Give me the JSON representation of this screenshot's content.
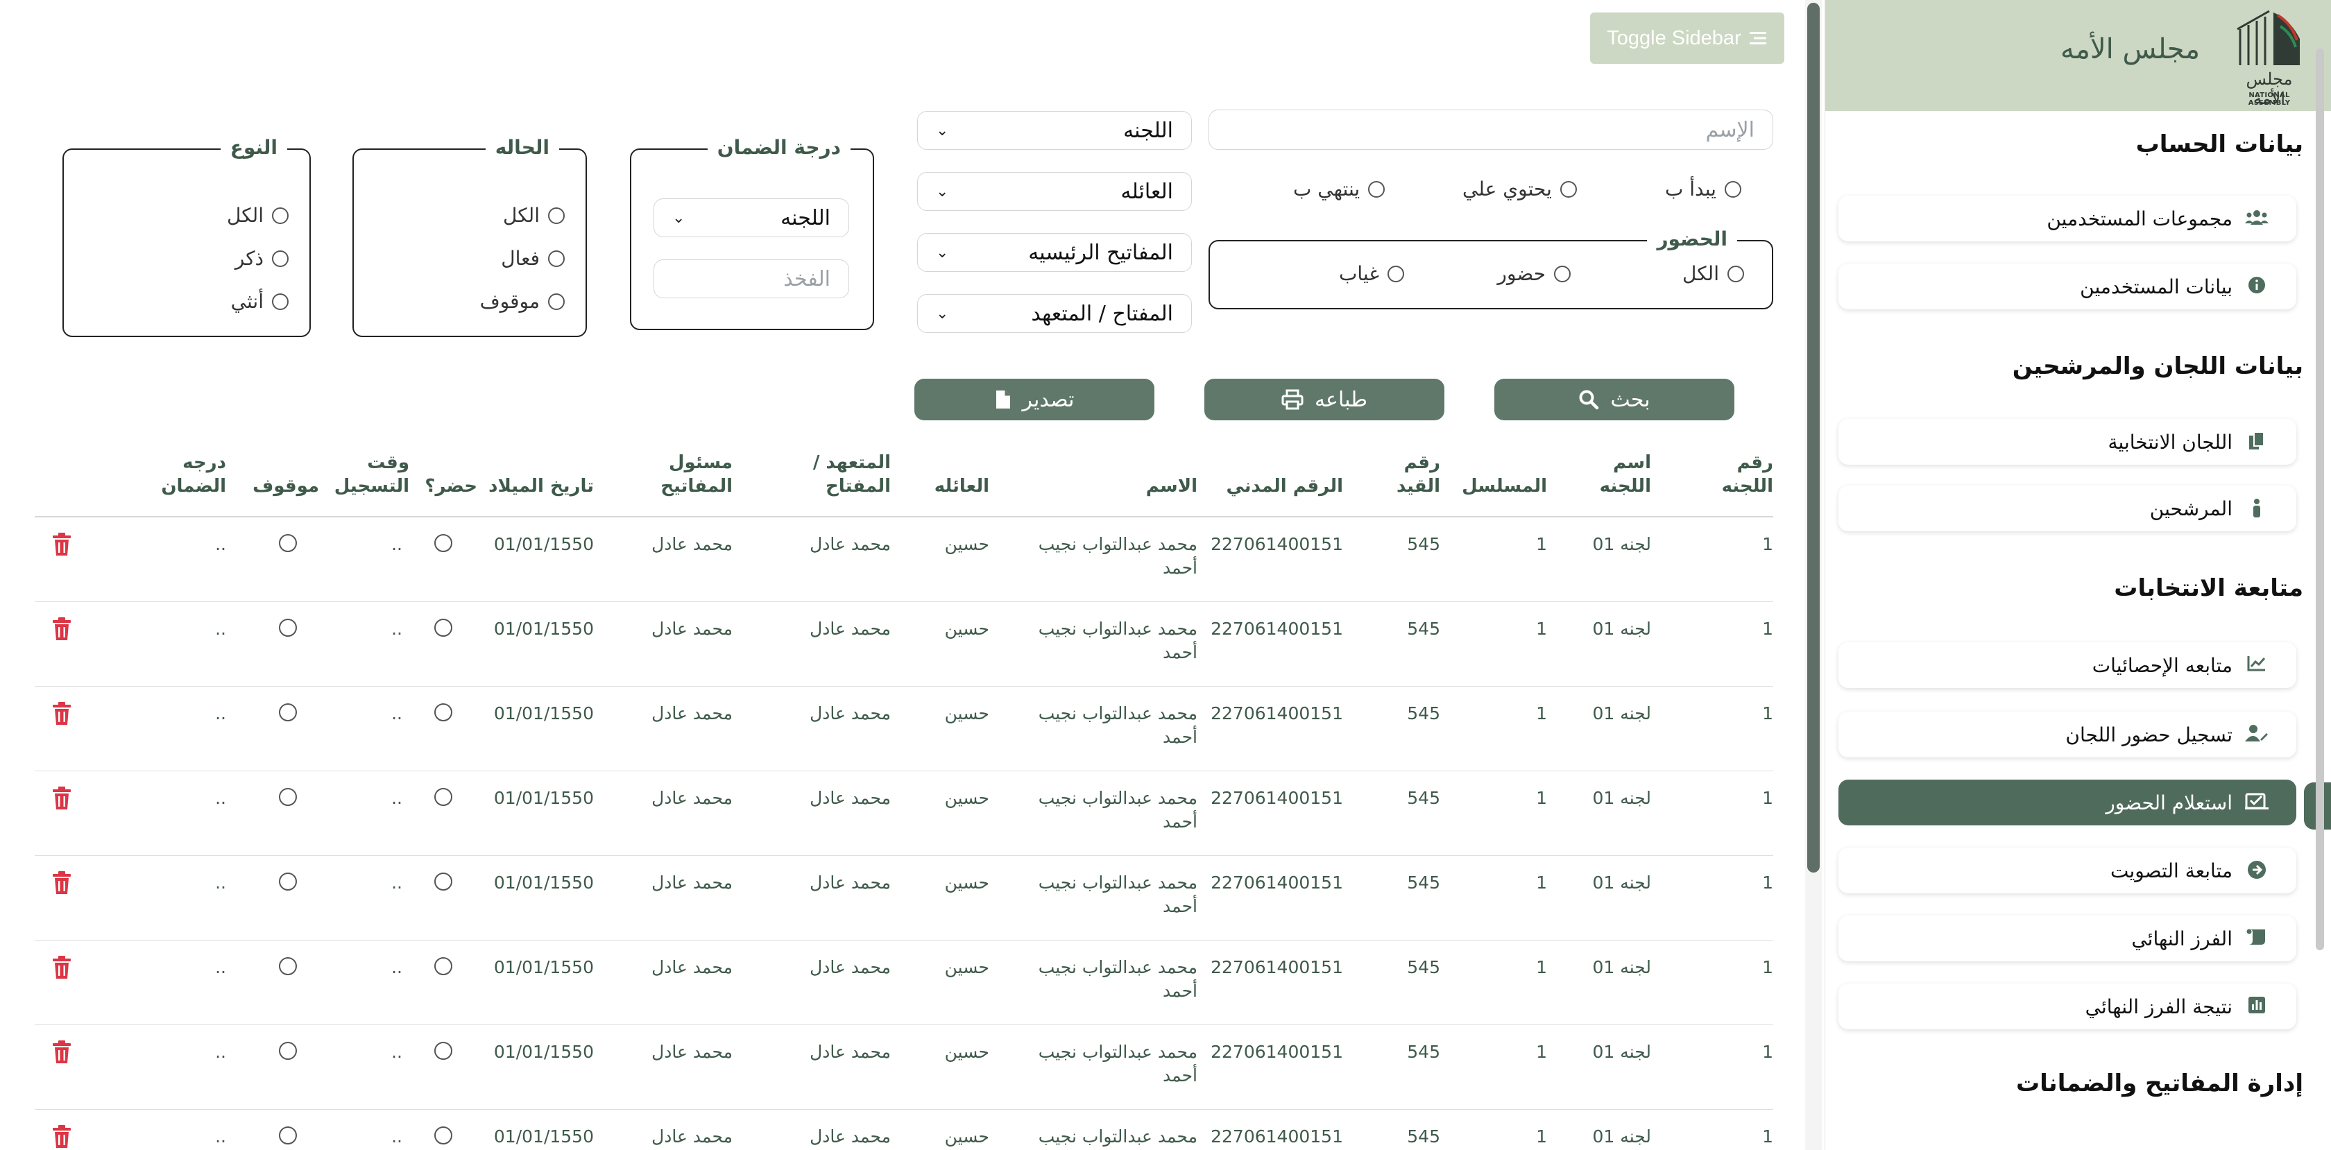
{
  "sidebar": {
    "title": "مجلس الأمه",
    "logo_text_ar": "مجلس الأمة",
    "logo_text_en": "NATIONAL ASSEMBLY",
    "sections": [
      {
        "label": "بيانات الحساب"
      },
      {
        "label": "بيانات اللجان والمرشحين"
      },
      {
        "label": "متابعة الانتخابات"
      },
      {
        "label": "إدارة المفاتيح والضمانات"
      }
    ],
    "items": [
      {
        "label": "مجموعات المستخدمين",
        "icon": "users-icon"
      },
      {
        "label": "بيانات المستخدمين",
        "icon": "info-icon"
      },
      {
        "label": "اللجان الانتخابية",
        "icon": "copy-icon"
      },
      {
        "label": "المرشحين",
        "icon": "person-icon"
      },
      {
        "label": "متابعه الإحصائيات",
        "icon": "chart-line-icon"
      },
      {
        "label": "تسجيل حضور اللجان",
        "icon": "user-edit-icon"
      },
      {
        "label": "استعلام الحضور",
        "icon": "checklist-icon",
        "active": true
      },
      {
        "label": "متابعة التصويت",
        "icon": "arrow-circle-icon"
      },
      {
        "label": "الفرز النهائي",
        "icon": "scroll-icon"
      },
      {
        "label": "نتيجة الفرز النهائي",
        "icon": "bar-chart-icon"
      }
    ]
  },
  "header": {
    "toggle_label": "Toggle Sidebar"
  },
  "filters": {
    "name_placeholder": "الإسم",
    "match_options": [
      "يبدأ ب",
      "يحتوي علي",
      "ينتهي ب"
    ],
    "attendance_legend": "الحضور",
    "attendance_options": [
      "الكل",
      "حضور",
      "غياب"
    ],
    "committee_select": "اللجنه",
    "family_select": "العائله",
    "main_keys_select": "المفاتيح الرئيسيه",
    "key_select": "المفتاح / المتعهد",
    "guarantee_legend": "درجة الضمان",
    "guarantee_select": "اللجنه",
    "branch_placeholder": "الفخذ",
    "status_legend": "الحاله",
    "status_options": [
      "الكل",
      "فعال",
      "موقوف"
    ],
    "type_legend": "النوع",
    "type_options": [
      "الكل",
      "ذكر",
      "أنثي"
    ]
  },
  "actions": {
    "search": "بحث",
    "print": "طباعه",
    "export": "تصدير"
  },
  "table": {
    "headers": {
      "committee_no": "رقم\nاللجنه",
      "committee_name": "اسم\nاللجنه",
      "serial": "المسلسل",
      "record_no": "رقم\nالقيد",
      "civil_id": "الرقم المدني",
      "name": "الاسم",
      "family": "العائله",
      "key": "المتعهد /\nالمفتاح",
      "key_owner": "مسئول\nالمفاتيح",
      "birth_date": "تاريخ الميلاد",
      "attended": "حضر؟",
      "reg_time": "وقت\nالتسجيل",
      "suspended": "موقوف",
      "guarantee": "درجه\nالضمان"
    },
    "rows": [
      {
        "committee_no": "1",
        "committee_name": "لجنه 01",
        "serial": "1",
        "record_no": "545",
        "civil_id": "227061400151",
        "name": "محمد عبدالتواب نجيب\nأحمد",
        "family": "حسين",
        "key": "محمد عادل",
        "key_owner": "محمد عادل",
        "birth_date": "01/01/1550",
        "reg_time": "..",
        "guarantee": ".."
      },
      {
        "committee_no": "1",
        "committee_name": "لجنه 01",
        "serial": "1",
        "record_no": "545",
        "civil_id": "227061400151",
        "name": "محمد عبدالتواب نجيب\nأحمد",
        "family": "حسين",
        "key": "محمد عادل",
        "key_owner": "محمد عادل",
        "birth_date": "01/01/1550",
        "reg_time": "..",
        "guarantee": ".."
      },
      {
        "committee_no": "1",
        "committee_name": "لجنه 01",
        "serial": "1",
        "record_no": "545",
        "civil_id": "227061400151",
        "name": "محمد عبدالتواب نجيب\nأحمد",
        "family": "حسين",
        "key": "محمد عادل",
        "key_owner": "محمد عادل",
        "birth_date": "01/01/1550",
        "reg_time": "..",
        "guarantee": ".."
      },
      {
        "committee_no": "1",
        "committee_name": "لجنه 01",
        "serial": "1",
        "record_no": "545",
        "civil_id": "227061400151",
        "name": "محمد عبدالتواب نجيب\nأحمد",
        "family": "حسين",
        "key": "محمد عادل",
        "key_owner": "محمد عادل",
        "birth_date": "01/01/1550",
        "reg_time": "..",
        "guarantee": ".."
      },
      {
        "committee_no": "1",
        "committee_name": "لجنه 01",
        "serial": "1",
        "record_no": "545",
        "civil_id": "227061400151",
        "name": "محمد عبدالتواب نجيب\nأحمد",
        "family": "حسين",
        "key": "محمد عادل",
        "key_owner": "محمد عادل",
        "birth_date": "01/01/1550",
        "reg_time": "..",
        "guarantee": ".."
      },
      {
        "committee_no": "1",
        "committee_name": "لجنه 01",
        "serial": "1",
        "record_no": "545",
        "civil_id": "227061400151",
        "name": "محمد عبدالتواب نجيب\nأحمد",
        "family": "حسين",
        "key": "محمد عادل",
        "key_owner": "محمد عادل",
        "birth_date": "01/01/1550",
        "reg_time": "..",
        "guarantee": ".."
      },
      {
        "committee_no": "1",
        "committee_name": "لجنه 01",
        "serial": "1",
        "record_no": "545",
        "civil_id": "227061400151",
        "name": "محمد عبدالتواب نجيب\nأحمد",
        "family": "حسين",
        "key": "محمد عادل",
        "key_owner": "محمد عادل",
        "birth_date": "01/01/1550",
        "reg_time": "..",
        "guarantee": ".."
      },
      {
        "committee_no": "1",
        "committee_name": "لجنه 01",
        "serial": "1",
        "record_no": "545",
        "civil_id": "227061400151",
        "name": "محمد عبدالتواب نجيب",
        "family": "حسين",
        "key": "محمد عادل",
        "key_owner": "محمد عادل",
        "birth_date": "01/01/1550",
        "reg_time": "..",
        "guarantee": ".."
      }
    ]
  },
  "colors": {
    "brand_light": "#ccd8c3",
    "brand_dark": "#4f6b5c",
    "button": "#5f786a",
    "danger": "#dc3545",
    "text_green": "#3f5a4b"
  }
}
